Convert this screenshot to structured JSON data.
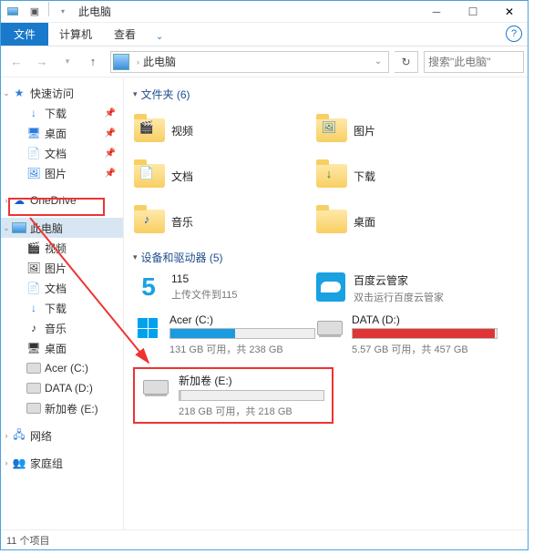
{
  "titlebar": {
    "title": "此电脑"
  },
  "ribbon": {
    "file": "文件",
    "computer": "计算机",
    "view": "查看"
  },
  "navbar": {
    "location": "此电脑",
    "search_placeholder": "搜索\"此电脑\""
  },
  "sidebar": {
    "quick": "快速访问",
    "quick_items": [
      {
        "label": "下载"
      },
      {
        "label": "桌面"
      },
      {
        "label": "文档"
      },
      {
        "label": "图片"
      }
    ],
    "onedrive": "OneDrive",
    "thispc": "此电脑",
    "pc_items": [
      {
        "label": "视频"
      },
      {
        "label": "图片"
      },
      {
        "label": "文档"
      },
      {
        "label": "下载"
      },
      {
        "label": "音乐"
      },
      {
        "label": "桌面"
      },
      {
        "label": "Acer (C:)"
      },
      {
        "label": "DATA (D:)"
      },
      {
        "label": "新加卷 (E:)"
      }
    ],
    "network": "网络",
    "homegroup": "家庭组"
  },
  "content": {
    "folders_header": "文件夹 (6)",
    "folders": [
      {
        "label": "视频",
        "overlay": "▸"
      },
      {
        "label": "图片",
        "overlay": ""
      },
      {
        "label": "文档",
        "overlay": "📄"
      },
      {
        "label": "下载",
        "overlay": "↓"
      },
      {
        "label": "音乐",
        "overlay": "♪"
      },
      {
        "label": "桌面",
        "overlay": ""
      }
    ],
    "drives_header": "设备和驱动器 (5)",
    "drives": {
      "app1": {
        "title": "115",
        "sub": "上传文件到115"
      },
      "app2": {
        "title": "百度云管家",
        "sub": "双击运行百度云管家"
      },
      "c": {
        "title": "Acer (C:)",
        "info": "131 GB 可用，共 238 GB",
        "pct": 45
      },
      "d": {
        "title": "DATA (D:)",
        "info": "5.57 GB 可用，共 457 GB",
        "pct": 99
      },
      "e": {
        "title": "新加卷 (E:)",
        "info": "218 GB 可用，共 218 GB",
        "pct": 1
      }
    }
  },
  "statusbar": {
    "items": "11 个项目"
  }
}
